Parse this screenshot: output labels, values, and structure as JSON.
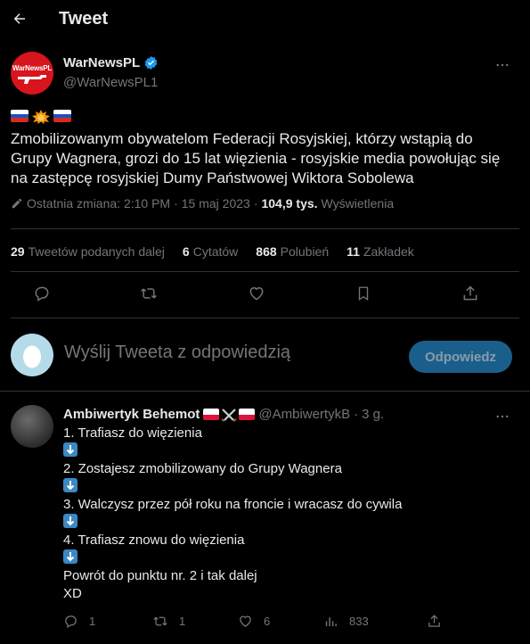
{
  "header": {
    "title": "Tweet"
  },
  "tweet": {
    "author": {
      "name": "WarNewsPL",
      "handle": "@WarNewsPL1",
      "logo_text": "WarNewsPL"
    },
    "text": "Zmobilizowanym obywatelom Federacji Rosyjskiej, którzy wstąpią do Grupy Wagnera, grozi do 15 lat więzienia - rosyjskie media powołując się na zastępcę rosyjskiej Dumy Państwowej Wiktora Sobolewa",
    "meta": {
      "edited": "Ostatnia zmiana: 2:10 PM",
      "sep": "·",
      "date": "15 maj 2023",
      "views_count": "104,9 tys.",
      "views_label": "Wyświetlenia"
    },
    "stats": {
      "retweets_count": "29",
      "retweets_label": "Tweetów podanych dalej",
      "quotes_count": "6",
      "quotes_label": "Cytatów",
      "likes_count": "868",
      "likes_label": "Polubień",
      "bookmarks_count": "11",
      "bookmarks_label": "Zakładek"
    }
  },
  "reply_box": {
    "placeholder": "Wyślij Tweeta z odpowiedzią",
    "button": "Odpowiedz"
  },
  "reply": {
    "name": "Ambiwertyk Behemot",
    "handle": "@AmbiwertykB",
    "dot": "·",
    "time": "3 g.",
    "lines": [
      "1. Trafiasz do więzienia",
      "2. Zostajesz zmobilizowany do Grupy Wagnera",
      "3. Walczysz przez pół roku na froncie i wracasz do cywila",
      "4. Trafiasz znowu do więzienia",
      "Powrót do punktu nr. 2 i tak dalej",
      "XD"
    ],
    "counts": {
      "replies": "1",
      "retweets": "1",
      "likes": "6",
      "views": "833"
    }
  },
  "colors": {
    "accent": "#1d9bf0",
    "muted": "#71767b",
    "reply_button": "#1a5f8c"
  }
}
